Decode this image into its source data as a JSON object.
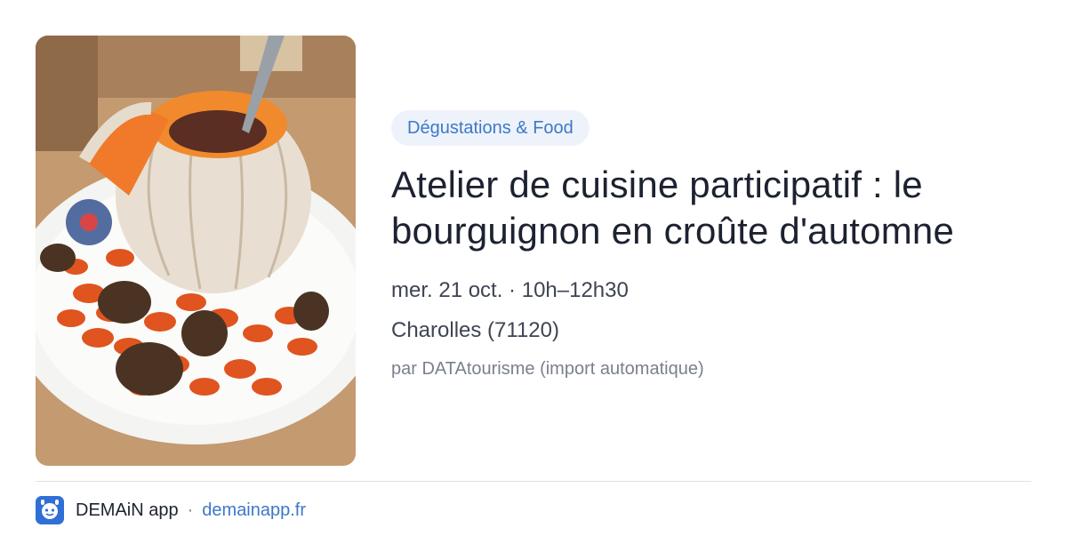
{
  "image": {
    "subject": "bourguignon-in-pumpkin-crust-plate-photo"
  },
  "event": {
    "category": "Dégustations & Food",
    "title": "Atelier de cuisine participatif : le bourguignon en croûte d'automne",
    "datetime": "mer. 21 oct. · 10h–12h30",
    "location": "Charolles (71120)",
    "source": "par DATAtourisme (import automatique)"
  },
  "footer": {
    "logo_icon": "demain-app-logo-icon",
    "app_name": "DEMAiN app",
    "separator": "·",
    "url": "demainapp.fr"
  },
  "colors": {
    "accent": "#3d78c9",
    "badge_bg": "#eef3fb",
    "title": "#1c2230",
    "muted": "#7a808c"
  }
}
